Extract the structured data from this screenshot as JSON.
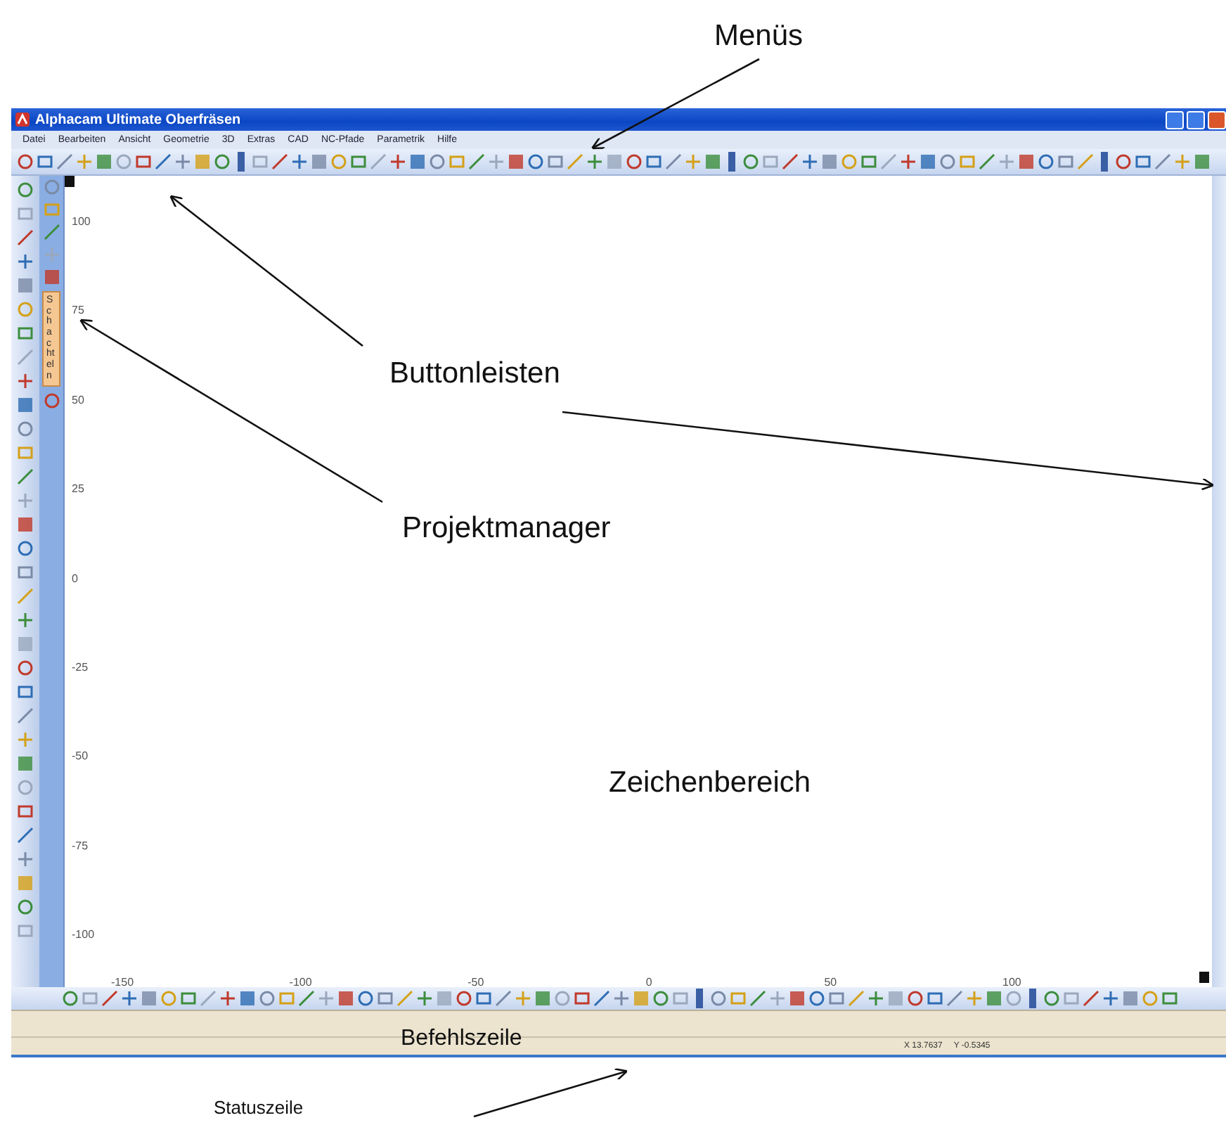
{
  "window": {
    "title": "Alphacam Ultimate Oberfräsen"
  },
  "menu": [
    {
      "label": "Datei"
    },
    {
      "label": "Bearbeiten"
    },
    {
      "label": "Ansicht"
    },
    {
      "label": "Geometrie"
    },
    {
      "label": "3D"
    },
    {
      "label": "Extras"
    },
    {
      "label": "CAD"
    },
    {
      "label": "NC-Pfade"
    },
    {
      "label": "Parametrik"
    },
    {
      "label": "Hilfe"
    }
  ],
  "project_manager": {
    "tab": "Schachteln"
  },
  "drawing_area": {
    "y_ticks": [
      "100",
      "75",
      "50",
      "25",
      "0",
      "-25",
      "-50",
      "-75",
      "-100"
    ],
    "x_ticks": [
      "-150",
      "-100",
      "-50",
      "0",
      "50",
      "100"
    ]
  },
  "status_bar": {
    "x": "X 13.7637",
    "y": "Y -0.5345"
  },
  "annotations": [
    {
      "text": "Menüs"
    },
    {
      "text": "Buttonleisten"
    },
    {
      "text": "Projektmanager"
    },
    {
      "text": "Zeichenbereich"
    },
    {
      "text": "Befehlszeile"
    },
    {
      "text": "Statuszeile"
    }
  ]
}
